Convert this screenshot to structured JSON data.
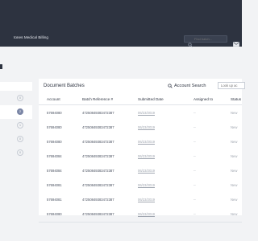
{
  "header": {
    "brand": "tones Medical Billing",
    "search_placeholder": "Find batch...",
    "colors": {
      "bar": "#2d3340",
      "accent": "#7b86a6"
    }
  },
  "sidebar": {
    "items": [
      {
        "badge": "0",
        "active": false
      },
      {
        "badge": "2",
        "active": true
      },
      {
        "badge": "1",
        "active": false
      },
      {
        "badge": "0",
        "active": false
      },
      {
        "badge": "0",
        "active": false
      }
    ]
  },
  "main": {
    "title": "Document Batches",
    "account_search_label": "Account Search",
    "lookup_placeholder": "Look up ac",
    "columns": [
      "Account",
      "Batch Reference #",
      "Submitted Date",
      "Assigned to",
      "Status"
    ],
    "rows": [
      {
        "account": "57694080",
        "batch": "47250849383472387",
        "date": "06/23/2019",
        "assigned": "--",
        "status": "New"
      },
      {
        "account": "57694080",
        "batch": "47250849383472387",
        "date": "06/23/2019",
        "assigned": "--",
        "status": "New"
      },
      {
        "account": "57694080",
        "batch": "47250849383472387",
        "date": "06/23/2019",
        "assigned": "--",
        "status": "New"
      },
      {
        "account": "57694084",
        "batch": "47250849383472387",
        "date": "06/23/2019",
        "assigned": "--",
        "status": "New"
      },
      {
        "account": "57694084",
        "batch": "47250849383472387",
        "date": "06/23/2019",
        "assigned": "--",
        "status": "New"
      },
      {
        "account": "57694081",
        "batch": "47250849383472387",
        "date": "06/23/2019",
        "assigned": "--",
        "status": "New"
      },
      {
        "account": "57694081",
        "batch": "47250849383472387",
        "date": "06/23/2019",
        "assigned": "--",
        "status": "New"
      },
      {
        "account": "57694080",
        "batch": "47250849383472387",
        "date": "06/23/2019",
        "assigned": "--",
        "status": "New"
      }
    ]
  }
}
